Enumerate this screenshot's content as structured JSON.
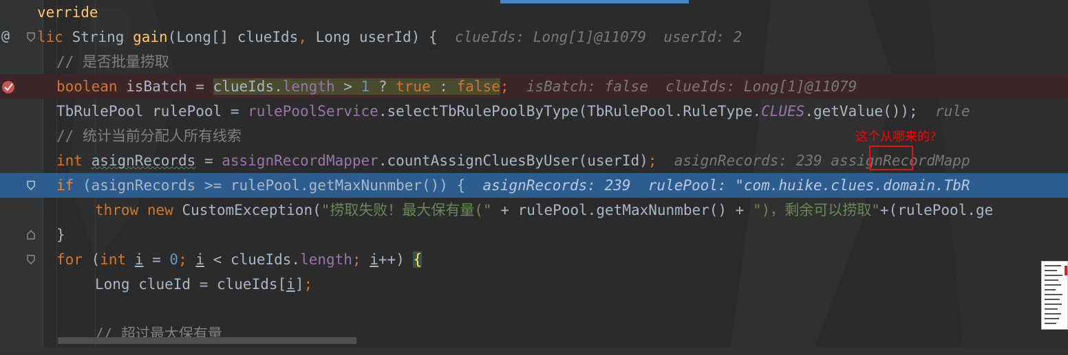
{
  "editor": {
    "lines": [
      {
        "gutter": "",
        "text": "verride"
      },
      {
        "gutter": "@",
        "signature": {
          "mod": "lic ",
          "type": "String ",
          "name": "gain",
          "params": "(Long[] clueIds",
          "comma": ",",
          "params2": " Long userId) {",
          "hint": "clueIds: Long[1]@11079  userId: 2"
        }
      },
      {
        "comment": "// 是否批量捞取"
      },
      {
        "decl": "boolean ",
        "var": "isBatch = ",
        "sel_a": "clueIds.",
        "sel_field": "length",
        "sel_b": " > ",
        "sel_num": "1",
        "sel_c": " ? ",
        "sel_kw1": "true",
        "sel_d": " : ",
        "sel_kw2": "false",
        "semi": ";",
        "hint": "isBatch: false  clueIds: Long[1]@11079"
      },
      {
        "a": "TbRulePool rulePool = ",
        "svc": "rulePoolService",
        "b": ".selectTbRulePoolByType(TbRulePool.RuleType.",
        "enum": "CLUES",
        "c": ".getValue());",
        "hint": "rule"
      },
      {
        "comment": "// 统计当前分配人所有线索"
      },
      {
        "kw": "int ",
        "var": "asignRecords",
        "a": " = ",
        "mapper": "assignRecordMapper",
        "b": ".countAssignCluesByUser(userId)",
        "semi": ";",
        "hint1": "asignRecords: ",
        "hint_val": "239",
        "hint2": " assignRecordMapp"
      },
      {
        "kw": "if",
        "a": " (asignRecords >= rulePool.getMaxNunmber()) {",
        "hint": "asignRecords: 239  rulePool: \"com.huike.clues.domain.TbR"
      },
      {
        "kw1": "throw ",
        "kw2": "new ",
        "a": "CustomException(",
        "str1": "\"捞取失败！最大保有量(\"",
        "b": " + rulePool.getMaxNunmber() + ",
        "str2": "\")，剩余可以捞取\"",
        "c": "+(rulePool.ge"
      },
      {
        "text": "}"
      },
      {
        "kw": "for",
        "a": " (",
        "kw2": "int ",
        "i1": "i",
        "b": " = ",
        "num": "0",
        "semi1": "; ",
        "i2": "i",
        "c": " < clueIds.",
        "fld": "length",
        "semi2": "; ",
        "i3": "i",
        "d": "++) ",
        "brace": "{"
      },
      {
        "a": "Long clueId = clueIds[",
        "i": "i",
        "b": "]",
        "semi": ";"
      },
      {
        "text": ""
      },
      {
        "comment": "// 超过最大保有量"
      }
    ]
  },
  "annotation": {
    "note": "这个从哪来的?",
    "color": "#ff0000"
  },
  "icons": {
    "override": "override-at-icon",
    "breakpoint": "breakpoint-icon",
    "fold": "fold-icon"
  },
  "colors": {
    "background": "#2b2b2b",
    "keyword": "#cc7832",
    "breakpoint_line": "#3c2627",
    "execution_line": "#2d5c8f"
  }
}
